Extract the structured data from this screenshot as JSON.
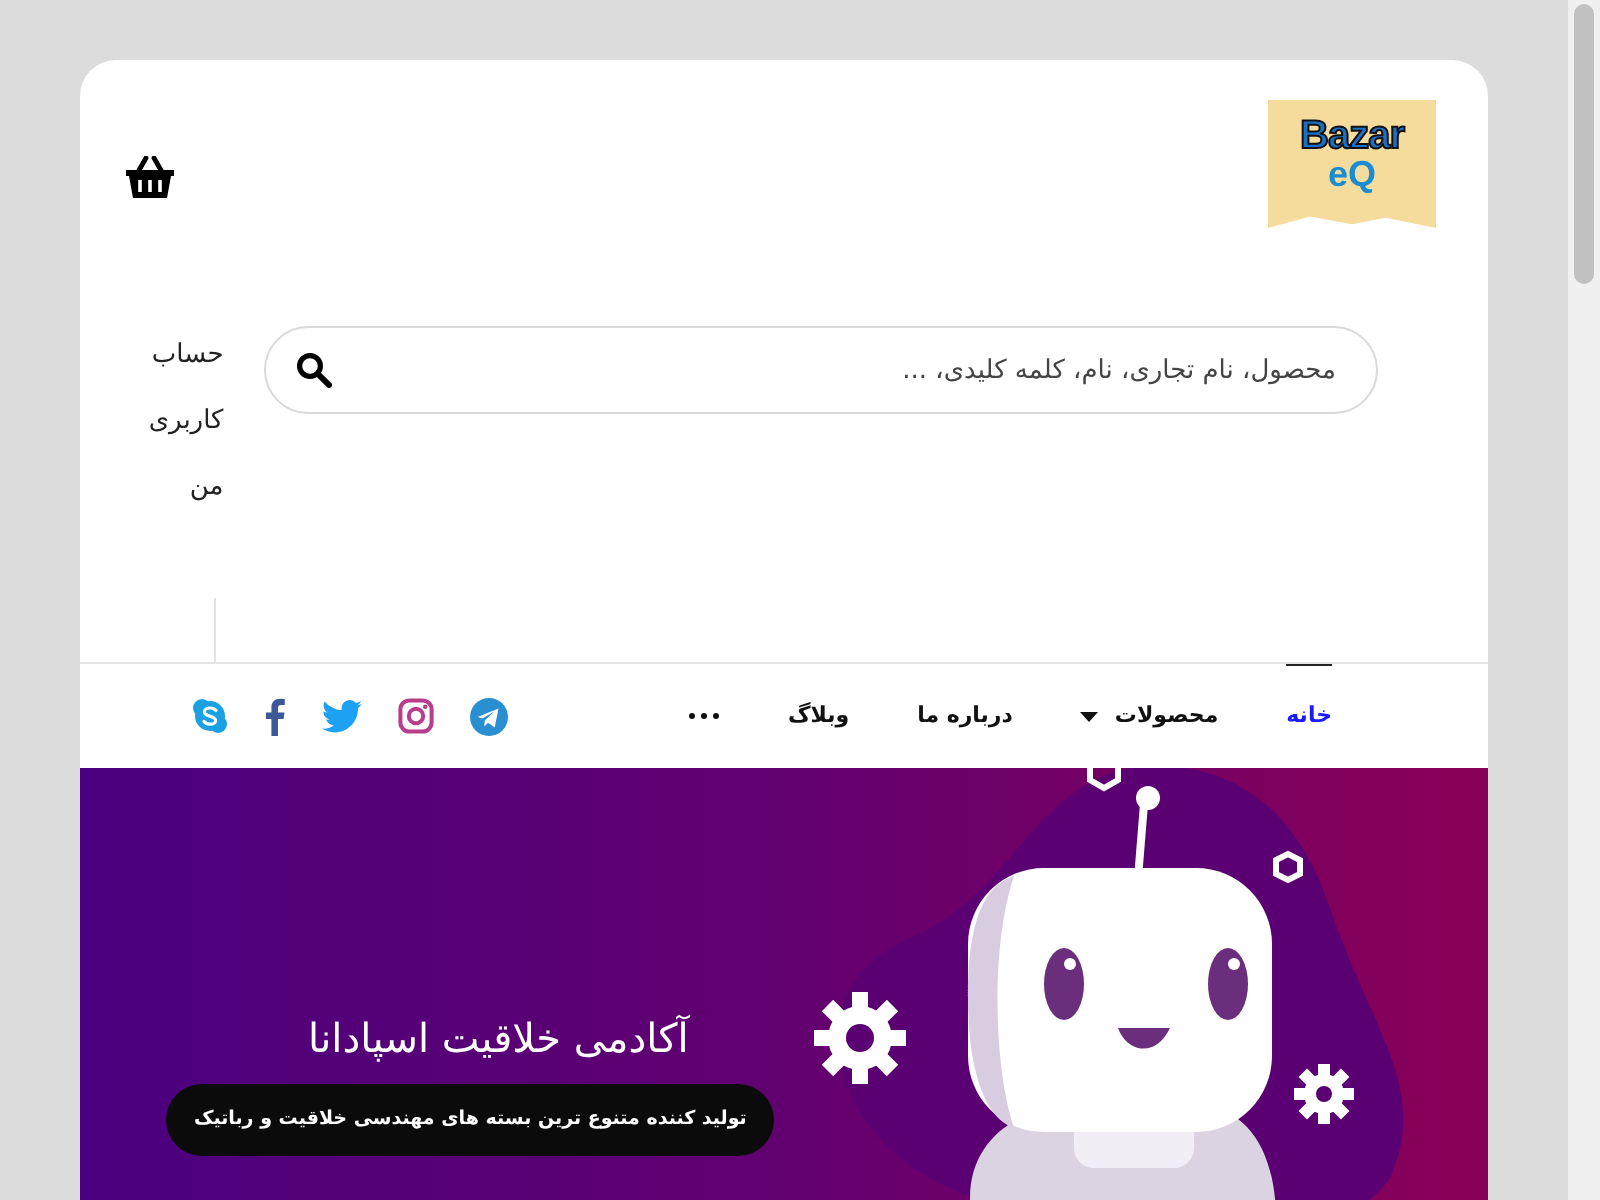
{
  "header": {
    "logo": {
      "line_1": "Bazar",
      "line_2": "eQ"
    }
  },
  "search": {
    "placeholder": "محصول، نام تجاری، نام، کلمه کلیدی، ..."
  },
  "account_link": "حساب کاربری من",
  "nav": {
    "items": [
      {
        "label": "خانه",
        "selected": true,
        "dropdown": false
      },
      {
        "label": "محصولات",
        "selected": false,
        "dropdown": true
      },
      {
        "label": "درباره ما",
        "selected": false,
        "dropdown": false
      },
      {
        "label": "وبلاگ",
        "selected": false,
        "dropdown": false
      }
    ],
    "social": [
      {
        "kind": "telegram"
      },
      {
        "kind": "instagram"
      },
      {
        "kind": "twitter"
      },
      {
        "kind": "facebook"
      },
      {
        "kind": "skype"
      }
    ]
  },
  "hero": {
    "title": "آکادمی خلاقیت اسپادانا",
    "button": "تولید کننده متنوع ترین بسته های مهندسی خلاقیت و رباتیک"
  }
}
